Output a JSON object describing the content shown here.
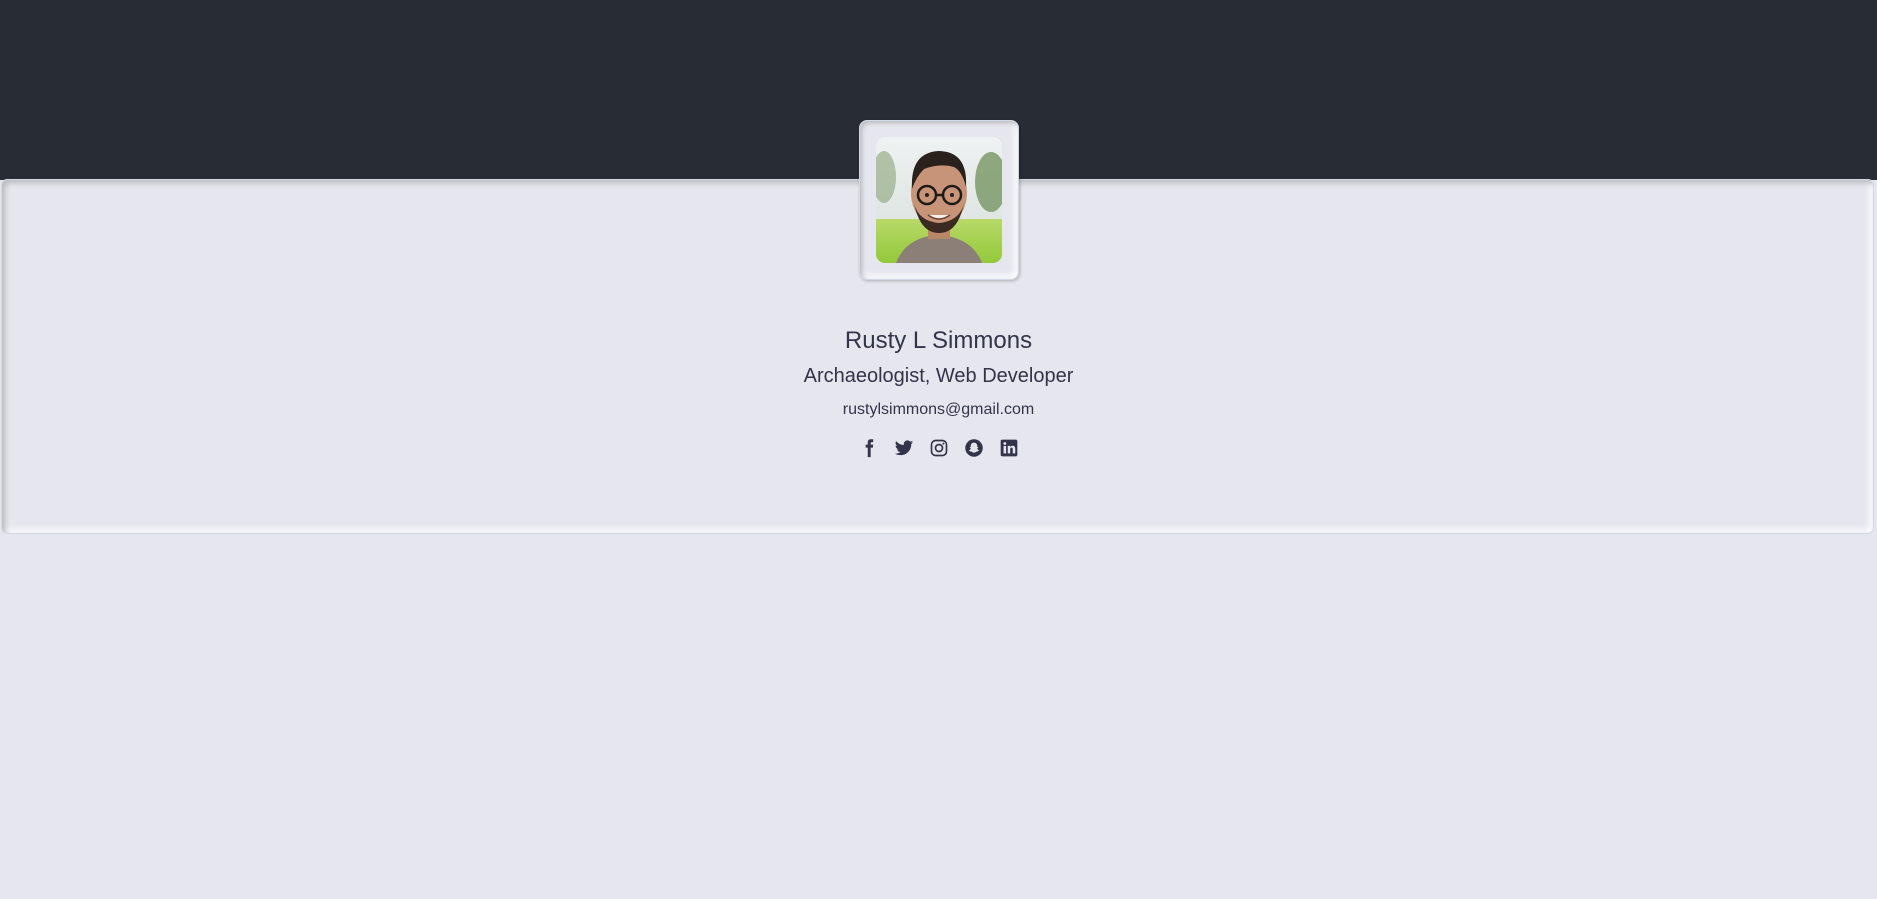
{
  "profile": {
    "name": "Rusty L Simmons",
    "role": "Archaeologist, Web Developer",
    "email": "rustylsimmons@gmail.com",
    "avatar_alt": "Profile photo"
  },
  "socials": [
    {
      "icon": "facebook-icon"
    },
    {
      "icon": "twitter-icon"
    },
    {
      "icon": "instagram-icon"
    },
    {
      "icon": "snapchat-icon"
    },
    {
      "icon": "linkedin-icon"
    }
  ],
  "colors": {
    "header": "#282c35",
    "background": "#e6e7ee",
    "text": "#31344b"
  }
}
